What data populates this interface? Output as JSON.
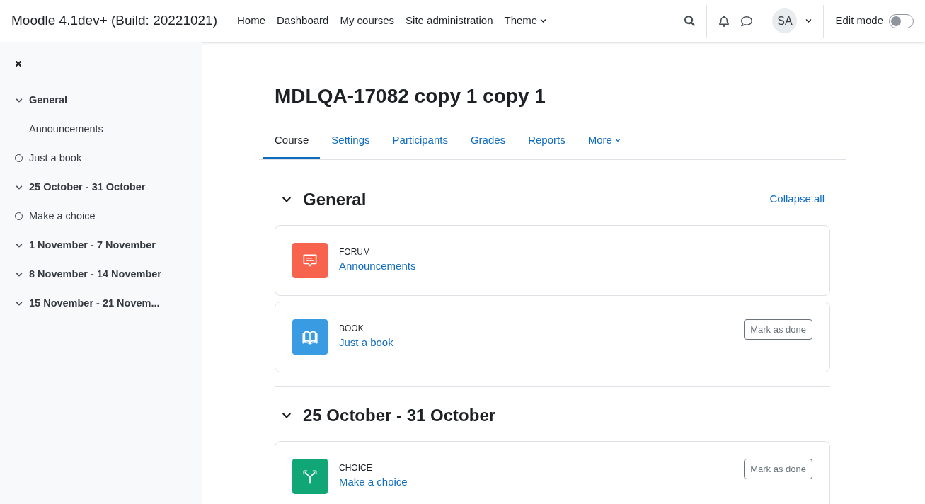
{
  "navbar": {
    "site_name": "Moodle 4.1dev+ (Build: 20221021)",
    "links": [
      {
        "label": "Home",
        "dropdown": false
      },
      {
        "label": "Dashboard",
        "dropdown": false
      },
      {
        "label": "My courses",
        "dropdown": false
      },
      {
        "label": "Site administration",
        "dropdown": false
      },
      {
        "label": "Theme",
        "dropdown": true
      }
    ],
    "avatar_initials": "SA",
    "edit_mode": {
      "label": "Edit mode",
      "on": false
    }
  },
  "sidebar": {
    "items": [
      {
        "kind": "section",
        "label": "General"
      },
      {
        "kind": "activity",
        "label": "Announcements",
        "tracked": false
      },
      {
        "kind": "activity",
        "label": "Just a book",
        "tracked": true
      },
      {
        "kind": "section",
        "label": "25 October - 31 October"
      },
      {
        "kind": "activity",
        "label": "Make a choice",
        "tracked": true
      },
      {
        "kind": "section",
        "label": "1 November - 7 November"
      },
      {
        "kind": "section",
        "label": "8 November - 14 November"
      },
      {
        "kind": "section",
        "label": "15 November - 21 Novem..."
      }
    ]
  },
  "page_title": "MDLQA-17082 copy 1 copy 1",
  "tabs": [
    {
      "label": "Course",
      "selected": true,
      "dropdown": false
    },
    {
      "label": "Settings",
      "selected": false,
      "dropdown": false
    },
    {
      "label": "Participants",
      "selected": false,
      "dropdown": false
    },
    {
      "label": "Grades",
      "selected": false,
      "dropdown": false
    },
    {
      "label": "Reports",
      "selected": false,
      "dropdown": false
    },
    {
      "label": "More",
      "selected": false,
      "dropdown": true
    }
  ],
  "collapse_all": "Collapse all",
  "sections": [
    {
      "title": "General",
      "expanded": true,
      "activities": [
        {
          "kind": "forum",
          "type_label": "FORUM",
          "name": "Announcements"
        },
        {
          "kind": "book",
          "type_label": "BOOK",
          "name": "Just a book",
          "button": "Mark as done"
        }
      ]
    },
    {
      "title": "25 October - 31 October",
      "expanded": true,
      "activities": [
        {
          "kind": "choice",
          "type_label": "CHOICE",
          "name": "Make a choice",
          "button": "Mark as done"
        }
      ]
    }
  ]
}
